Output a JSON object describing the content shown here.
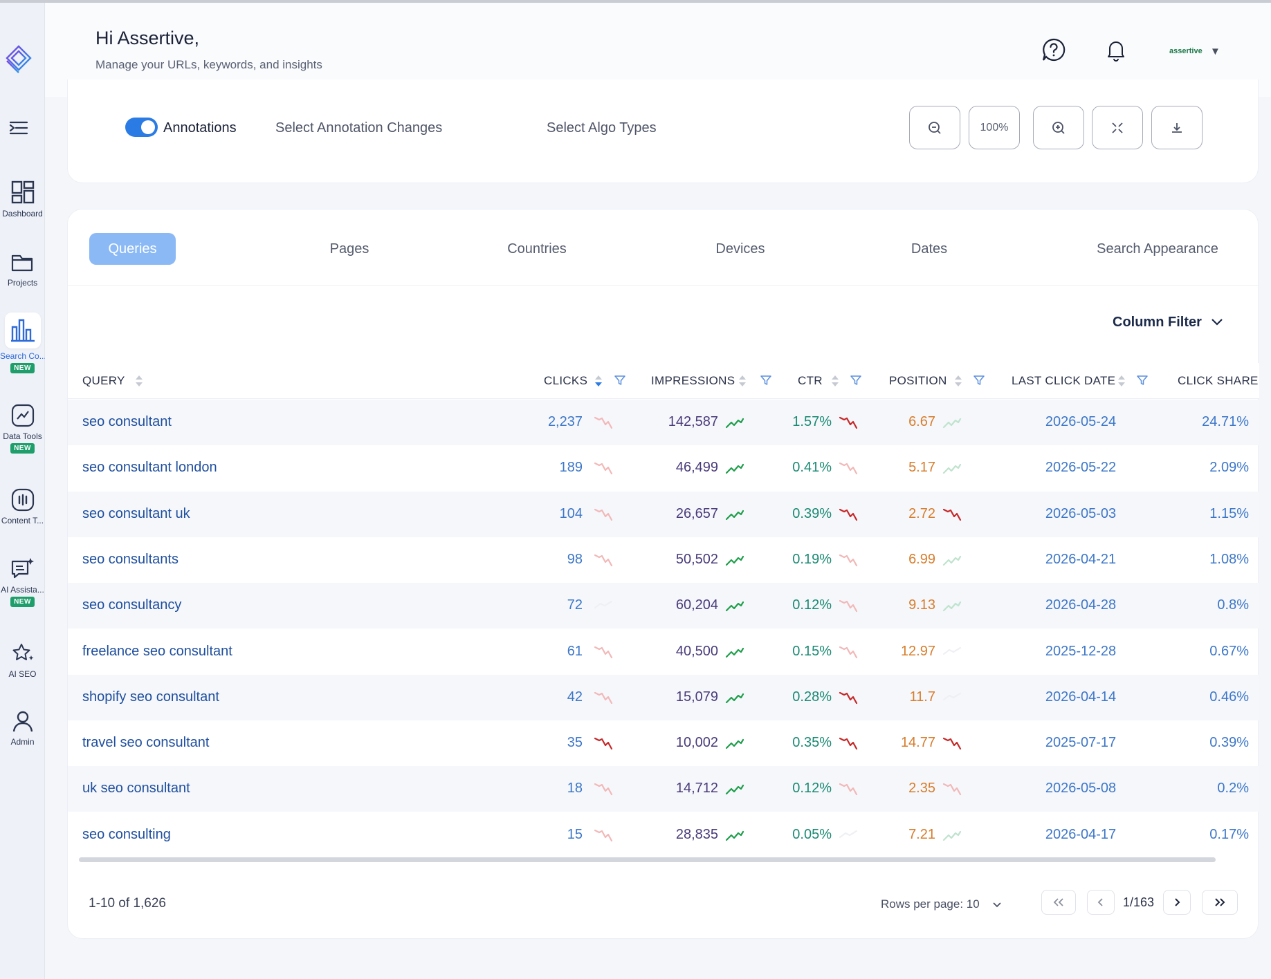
{
  "header": {
    "greeting": "Hi Assertive,",
    "subtitle": "Manage your URLs, keywords, and insights",
    "user": "assertive"
  },
  "sidebar": {
    "items": [
      {
        "label": "Dashboard",
        "icon": "dashboard-icon",
        "new": false
      },
      {
        "label": "Projects",
        "icon": "folder-icon",
        "new": false
      },
      {
        "label": "Search Co...",
        "icon": "bar-chart-icon",
        "new": true,
        "active": true
      },
      {
        "label": "Data Tools",
        "icon": "trend-icon",
        "new": true
      },
      {
        "label": "Content T...",
        "icon": "content-icon",
        "new": false
      },
      {
        "label": "AI Assista...",
        "icon": "ai-assistant-icon",
        "new": true
      },
      {
        "label": "AI SEO",
        "icon": "sparkle-star-icon",
        "new": false
      },
      {
        "label": "Admin",
        "icon": "user-icon",
        "new": false
      }
    ],
    "new_badge": "NEW"
  },
  "annotations": {
    "toggle_label": "Annotations",
    "toggle_on": true,
    "select_changes": "Select Annotation Changes",
    "select_algo": "Select Algo Types",
    "zoom_level": "100%"
  },
  "tabs": [
    "Queries",
    "Pages",
    "Countries",
    "Devices",
    "Dates",
    "Search Appearance"
  ],
  "column_filter": "Column Filter",
  "table": {
    "headers": {
      "query": "QUERY",
      "clicks": "CLICKS",
      "impressions": "IMPRESSIONS",
      "ctr": "CTR",
      "position": "POSITION",
      "last_click_date": "LAST CLICK DATE",
      "click_share": "CLICK SHARE"
    },
    "rows": [
      {
        "query": "seo consultant",
        "clicks": "2,237",
        "impressions": "142,587",
        "ctr": "1.57%",
        "position": "6.67",
        "date": "2026-05-24",
        "share": "24.71%",
        "trend": [
          "down-faint",
          "up",
          "down",
          "up-faint"
        ]
      },
      {
        "query": "seo consultant london",
        "clicks": "189",
        "impressions": "46,499",
        "ctr": "0.41%",
        "position": "5.17",
        "date": "2026-05-22",
        "share": "2.09%",
        "trend": [
          "down-faint",
          "up",
          "down-faint",
          "up-faint"
        ]
      },
      {
        "query": "seo consultant uk",
        "clicks": "104",
        "impressions": "26,657",
        "ctr": "0.39%",
        "position": "2.72",
        "date": "2026-05-03",
        "share": "1.15%",
        "trend": [
          "down-faint",
          "up",
          "down",
          "down"
        ]
      },
      {
        "query": "seo consultants",
        "clicks": "98",
        "impressions": "50,502",
        "ctr": "0.19%",
        "position": "6.99",
        "date": "2026-04-21",
        "share": "1.08%",
        "trend": [
          "down-faint",
          "up",
          "down-faint",
          "up-faint"
        ]
      },
      {
        "query": "seo consultancy",
        "clicks": "72",
        "impressions": "60,204",
        "ctr": "0.12%",
        "position": "9.13",
        "date": "2026-04-28",
        "share": "0.8%",
        "trend": [
          "none",
          "up",
          "down-faint",
          "up-faint"
        ]
      },
      {
        "query": "freelance seo consultant",
        "clicks": "61",
        "impressions": "40,500",
        "ctr": "0.15%",
        "position": "12.97",
        "date": "2025-12-28",
        "share": "0.67%",
        "trend": [
          "down-faint",
          "up",
          "down-faint",
          "none"
        ]
      },
      {
        "query": "shopify seo consultant",
        "clicks": "42",
        "impressions": "15,079",
        "ctr": "0.28%",
        "position": "11.7",
        "date": "2026-04-14",
        "share": "0.46%",
        "trend": [
          "down-faint",
          "up",
          "down",
          "none"
        ]
      },
      {
        "query": "travel seo consultant",
        "clicks": "35",
        "impressions": "10,002",
        "ctr": "0.35%",
        "position": "14.77",
        "date": "2025-07-17",
        "share": "0.39%",
        "trend": [
          "down",
          "up",
          "down",
          "down"
        ]
      },
      {
        "query": "uk seo consultant",
        "clicks": "18",
        "impressions": "14,712",
        "ctr": "0.12%",
        "position": "2.35",
        "date": "2026-05-08",
        "share": "0.2%",
        "trend": [
          "down-faint",
          "up",
          "down-faint",
          "down-faint"
        ]
      },
      {
        "query": "seo consulting",
        "clicks": "15",
        "impressions": "28,835",
        "ctr": "0.05%",
        "position": "7.21",
        "date": "2026-04-17",
        "share": "0.17%",
        "trend": [
          "down-faint",
          "up",
          "none",
          "up-faint"
        ]
      }
    ]
  },
  "pagination": {
    "range": "1-10 of 1,626",
    "rows_per_page": "Rows per page: 10",
    "page": "1/163"
  },
  "colors": {
    "accent": "#2b7be4",
    "tab_active": "#8bb9f6",
    "trend_up": "#1e9e4a",
    "trend_down": "#c62828"
  }
}
